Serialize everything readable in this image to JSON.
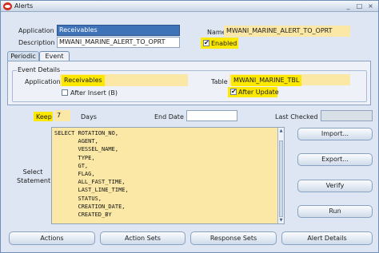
{
  "window": {
    "title": "Alerts",
    "minimize": "_",
    "maximize": "□",
    "close": "×"
  },
  "header": {
    "application_label": "Application",
    "application_value": "Receivables",
    "description_label": "Description",
    "description_value": "MWANI_MARINE_ALERT_TO_OPRT",
    "name_label": "Name",
    "name_value": "MWANI_MARINE_ALERT_TO_OPRT",
    "enabled_label": "Enabled",
    "enabled_checked": true
  },
  "tabs": [
    {
      "label": "Periodic",
      "active": false
    },
    {
      "label": "Event",
      "active": true
    }
  ],
  "event_details": {
    "group_label": "Event Details",
    "application_label": "Application",
    "application_value": "Receivables",
    "table_label": "Table",
    "table_value": "MWANI_MARINE_TBL",
    "after_insert_label": "After Insert (B)",
    "after_insert_checked": false,
    "after_update_label": "After Update",
    "after_update_checked": true
  },
  "keep": {
    "label": "Keep",
    "value": "7",
    "unit": "Days",
    "end_date_label": "End Date",
    "end_date_value": "",
    "last_checked_label": "Last Checked",
    "last_checked_value": ""
  },
  "statement": {
    "label": "Select Statement",
    "lines": [
      "SELECT ROTATION_NO,",
      "       AGENT,",
      "       VESSEL_NAME,",
      "       TYPE,",
      "       GT,",
      "       FLAG,",
      "       ALL_FAST_TIME,",
      "       LAST_LINE_TIME,",
      "       STATUS,",
      "       CREATION_DATE,",
      "       CREATED_BY"
    ]
  },
  "side_buttons": [
    "Import...",
    "Export...",
    "Verify",
    "Run"
  ],
  "bottom_buttons": [
    "Actions",
    "Action Sets",
    "Response Sets",
    "Alert Details"
  ],
  "colors": {
    "highlight": "#fce800",
    "field_yellow": "#fbe8a6",
    "selected_blue": "#3f73b8",
    "window_bg": "#dde6f2"
  }
}
